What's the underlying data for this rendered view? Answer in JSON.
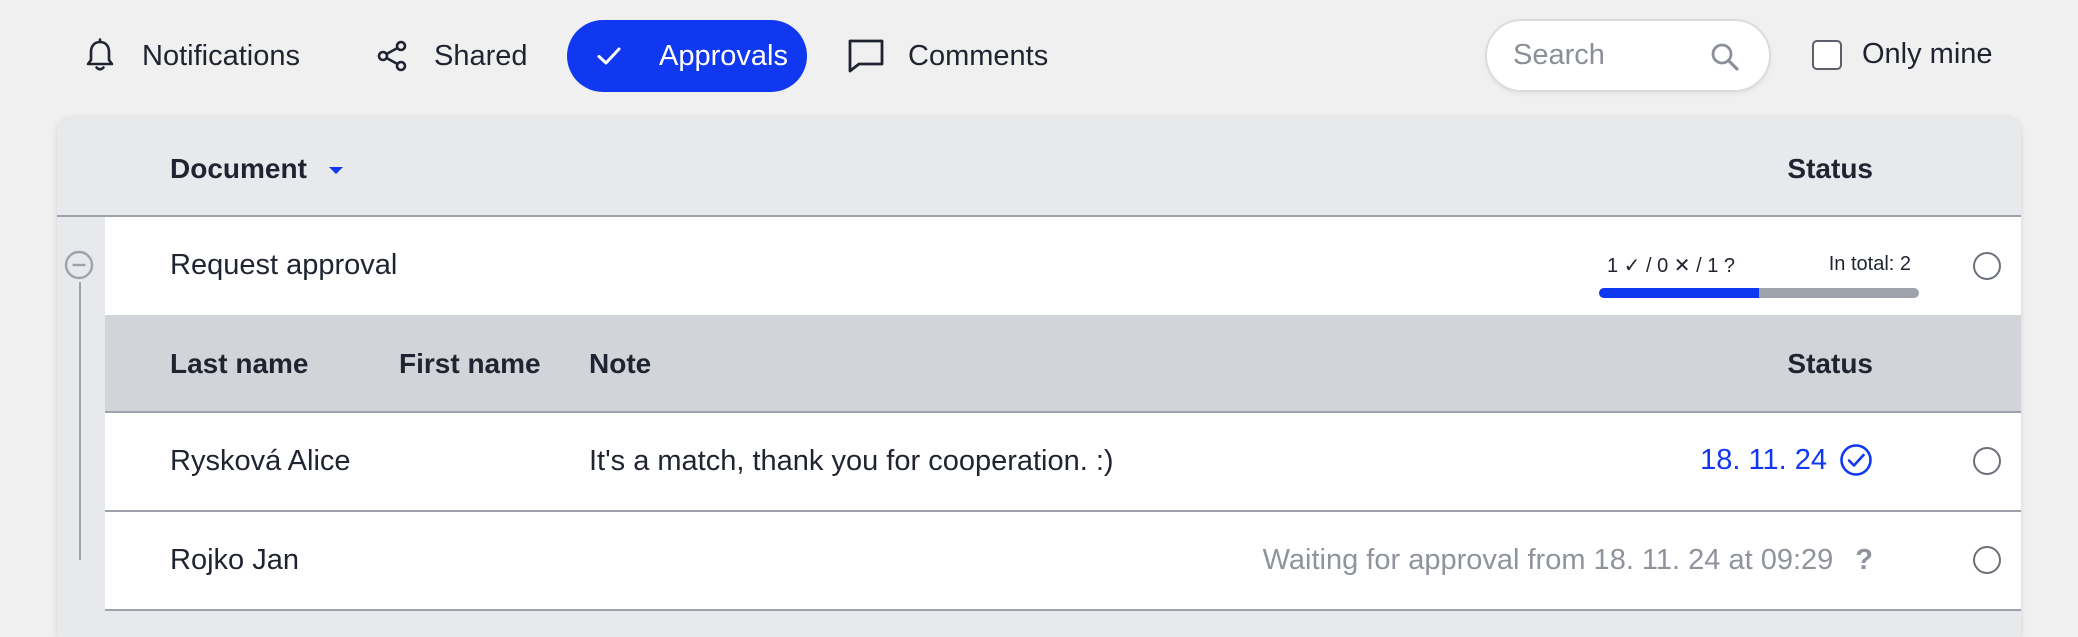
{
  "tabs": [
    {
      "label": "Notifications",
      "icon": "bell-icon",
      "active": false
    },
    {
      "label": "Shared",
      "icon": "share-icon",
      "active": false
    },
    {
      "label": "Approvals",
      "icon": "check-icon",
      "active": true
    },
    {
      "label": "Comments",
      "icon": "comment-icon",
      "active": false
    }
  ],
  "search": {
    "placeholder": "Search",
    "value": ""
  },
  "only_mine": {
    "label": "Only mine",
    "checked": false
  },
  "table": {
    "headers": {
      "document": "Document",
      "status": "Status"
    },
    "group": {
      "title": "Request approval",
      "summary": "1 ✓ / 0 ✕ / 1 ?",
      "total": "In total: 2",
      "progress": 0.5
    },
    "sub_headers": {
      "last_name": "Last name",
      "first_name": "First name",
      "note": "Note",
      "status": "Status"
    },
    "rows": [
      {
        "name": "Rysková Alice",
        "note": "It's a match, thank you for cooperation. :)",
        "status": "18. 11. 24",
        "state": "approved"
      },
      {
        "name": "Rojko Jan",
        "note": "",
        "status": "Waiting for approval from 18. 11. 24 at 09:29",
        "state_mark": "?",
        "state": "waiting"
      }
    ]
  },
  "colors": {
    "accent": "#1038f0",
    "muted": "#8f939b",
    "divider": "#9ea3ab"
  }
}
